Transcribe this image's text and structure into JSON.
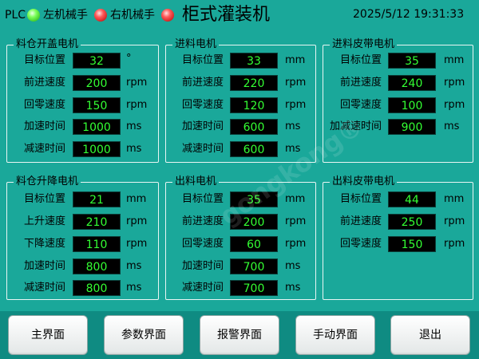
{
  "header": {
    "plc_label": "PLC",
    "left_arm_label": "左机械手",
    "right_arm_label": "右机械手",
    "title": "柜式灌装机",
    "datetime": "2025/5/12 19:31:33",
    "leds": {
      "plc": "green",
      "left_arm": "red",
      "right_arm": "red"
    }
  },
  "panels": {
    "bin_cover_motor": {
      "title": "料仓开盖电机",
      "rows": [
        {
          "label": "目标位置",
          "value": "32",
          "unit": "°"
        },
        {
          "label": "前进速度",
          "value": "200",
          "unit": "rpm"
        },
        {
          "label": "回零速度",
          "value": "150",
          "unit": "rpm"
        },
        {
          "label": "加速时间",
          "value": "1000",
          "unit": "ms"
        },
        {
          "label": "减速时间",
          "value": "1000",
          "unit": "ms"
        }
      ]
    },
    "feed_motor": {
      "title": "进料电机",
      "rows": [
        {
          "label": "目标位置",
          "value": "33",
          "unit": "mm"
        },
        {
          "label": "前进速度",
          "value": "220",
          "unit": "rpm"
        },
        {
          "label": "回零速度",
          "value": "120",
          "unit": "rpm"
        },
        {
          "label": "加速时间",
          "value": "600",
          "unit": "ms"
        },
        {
          "label": "减速时间",
          "value": "600",
          "unit": "ms"
        }
      ]
    },
    "feed_belt_motor": {
      "title": "进料皮带电机",
      "rows": [
        {
          "label": "目标位置",
          "value": "35",
          "unit": "mm"
        },
        {
          "label": "前进速度",
          "value": "240",
          "unit": "rpm"
        },
        {
          "label": "回零速度",
          "value": "100",
          "unit": "rpm"
        },
        {
          "label": "加减速时间",
          "value": "900",
          "unit": "ms"
        }
      ]
    },
    "bin_lift_motor": {
      "title": "料仓升降电机",
      "rows": [
        {
          "label": "目标位置",
          "value": "21",
          "unit": "mm"
        },
        {
          "label": "上升速度",
          "value": "210",
          "unit": "rpm"
        },
        {
          "label": "下降速度",
          "value": "110",
          "unit": "rpm"
        },
        {
          "label": "加速时间",
          "value": "800",
          "unit": "ms"
        },
        {
          "label": "减速时间",
          "value": "800",
          "unit": "ms"
        }
      ]
    },
    "discharge_motor": {
      "title": "出料电机",
      "rows": [
        {
          "label": "目标位置",
          "value": "35",
          "unit": "mm"
        },
        {
          "label": "前进速度",
          "value": "200",
          "unit": "rpm"
        },
        {
          "label": "回零速度",
          "value": "60",
          "unit": "rpm"
        },
        {
          "label": "加速时间",
          "value": "700",
          "unit": "ms"
        },
        {
          "label": "减速时间",
          "value": "700",
          "unit": "ms"
        }
      ]
    },
    "discharge_belt_motor": {
      "title": "出料皮带电机",
      "rows": [
        {
          "label": "目标位置",
          "value": "44",
          "unit": "mm"
        },
        {
          "label": "前进速度",
          "value": "250",
          "unit": "rpm"
        },
        {
          "label": "回零速度",
          "value": "150",
          "unit": "rpm"
        }
      ]
    }
  },
  "watermark": "gongkong®",
  "nav": {
    "main": "主界面",
    "params": "参数界面",
    "alarm": "报警界面",
    "manual": "手动界面",
    "exit": "退出"
  }
}
